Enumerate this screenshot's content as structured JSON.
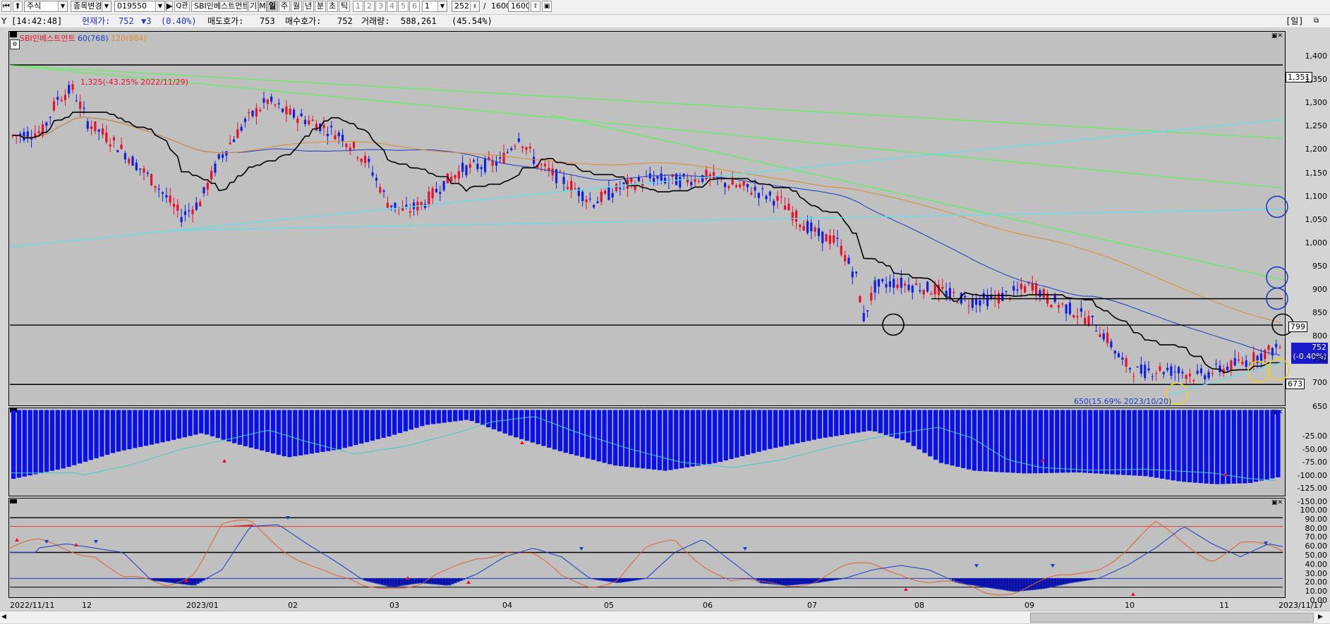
{
  "toolbar": {
    "market_type": "주식",
    "change_label": "종목변경",
    "code": "019550",
    "name": "SBI인베스트먼트",
    "flag_gi": "기",
    "flag_m": "M",
    "search_label": "Q관",
    "periods": [
      "일",
      "주",
      "월",
      "년",
      "분",
      "초",
      "틱"
    ],
    "period_selected": "일",
    "tabs": [
      "1",
      "2",
      "3",
      "4",
      "5",
      "6"
    ],
    "tab_value": "1",
    "count": "252",
    "total_sep": "/",
    "total": "1600",
    "total2": "1600"
  },
  "info_bar": {
    "time": "[14:42:48]",
    "price_label": "현재가:",
    "price": "752",
    "change": "▼3",
    "change_pct": "(0.40%)",
    "ask_label": "매도호가:",
    "ask": "753",
    "bid_label": "매수호가:",
    "bid": "752",
    "volume_label": "거래량:",
    "volume": "588,261",
    "volume_pct": "(45.54%)",
    "right_label": "[일]"
  },
  "legend": {
    "name": "SBI인베스트먼트",
    "ma60": "60(768)",
    "ma120": "120(884)"
  },
  "annotations": {
    "high": "1,325(-43.25% 2022/11/29)",
    "low": "650(15.69% 2023/10/20)"
  },
  "price_tags": {
    "top": "1,351",
    "mid": "799",
    "current": "752",
    "current_pct": "(-0.40%)",
    "bottom": "673"
  },
  "price_axis": [
    "1,400",
    "1,350",
    "1,300",
    "1,250",
    "1,200",
    "1,150",
    "1,100",
    "1,050",
    "1,000",
    "950",
    "900",
    "850",
    "800",
    "750",
    "700",
    "650"
  ],
  "macd_axis": [
    "-25.00",
    "-50.00",
    "-75.00",
    "-100.00",
    "-125.00",
    "-150.00"
  ],
  "stoch_axis": [
    "100.00",
    "90.00",
    "80.00",
    "70.00",
    "60.00",
    "50.00",
    "40.00",
    "30.00",
    "20.00",
    "10.00",
    "0.00"
  ],
  "x_axis": [
    "2022/11/11",
    "12",
    "2023/01",
    "02",
    "03",
    "04",
    "05",
    "06",
    "07",
    "08",
    "09",
    "10",
    "11",
    "2023/11/17"
  ],
  "colors": {
    "up": "#e8102a",
    "down": "#1020e0",
    "ma60": "#1a3cc8",
    "ma120": "#e08a2c",
    "trend_green": "#66ee66",
    "trend_cyan": "#66ddee"
  },
  "chart_data": [
    {
      "type": "candlestick",
      "title": "SBI인베스트먼트",
      "ylim": [
        630,
        1420
      ],
      "x": [
        "2022/11/11",
        "2023/11/17"
      ],
      "series": [
        {
          "name": "60(768)",
          "type": "line"
        },
        {
          "name": "120(884)",
          "type": "line"
        }
      ],
      "horizontal_levels": [
        1351,
        799,
        673
      ],
      "annotations": [
        {
          "label": "1,325(-43.25% 2022/11/29)",
          "value": 1325
        },
        {
          "label": "650(15.69% 2023/10/20)",
          "value": 650
        }
      ],
      "grid": false
    },
    {
      "type": "bar",
      "ylim": [
        -170,
        -10
      ],
      "grid": false
    },
    {
      "type": "line",
      "ylim": [
        0,
        100
      ],
      "levels": [
        20,
        50,
        80
      ],
      "grid": false
    }
  ]
}
